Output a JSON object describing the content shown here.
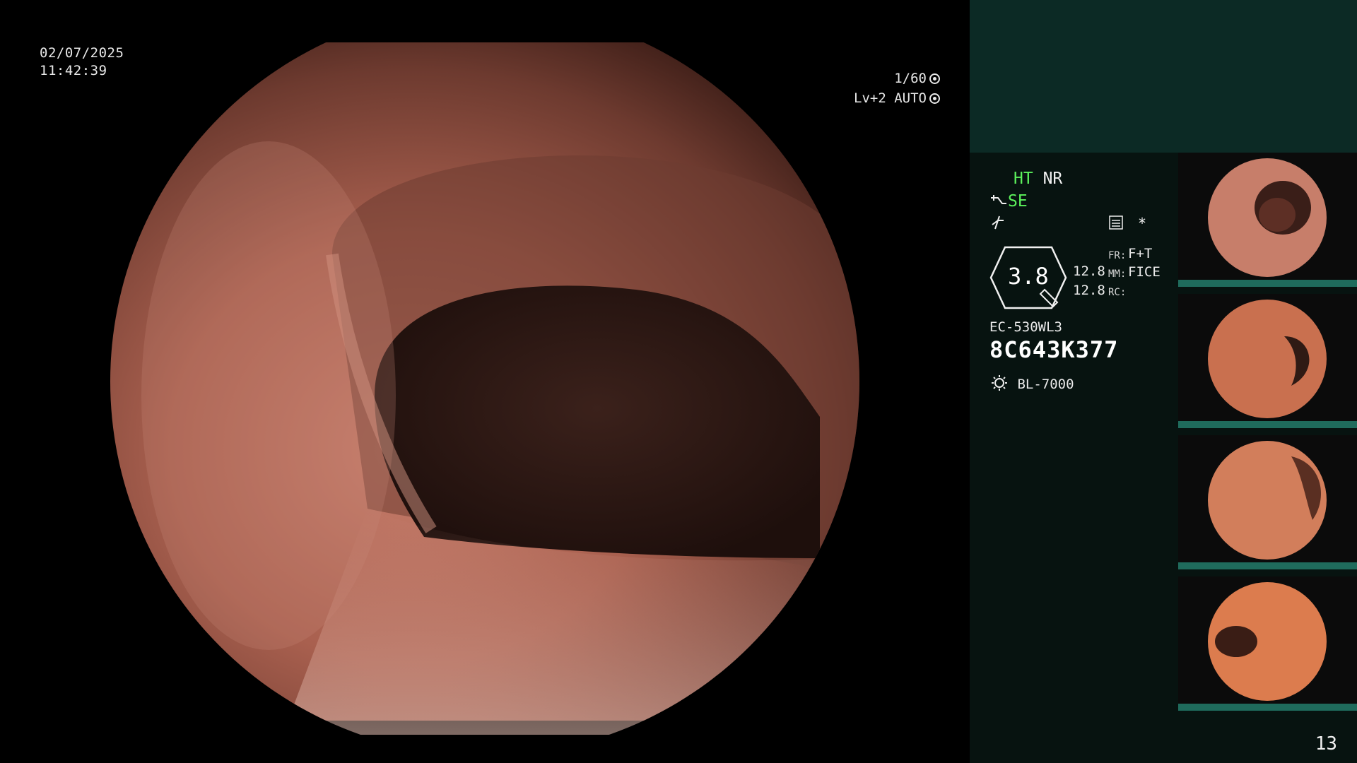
{
  "overlay": {
    "date": "02/07/2025",
    "time": "11:42:39",
    "shutter": "1/60",
    "level": "Lv+2 AUTO"
  },
  "side_panel": {
    "ht": "HT",
    "nr": "NR",
    "se": "SE",
    "badge_value": "3.8",
    "fr_label": "FR:",
    "fr_value": "F+T",
    "mm_label": "MM:",
    "mm_value": "FICE",
    "rc_label": "RC:",
    "value_1": "12.8",
    "value_2": "12.8",
    "asterisk": "*",
    "scope_model": "EC-530WL3",
    "serial": "8C643K377",
    "light_source": "BL-7000",
    "page_number": "13"
  },
  "colors": {
    "accent_green": "#5cf25c",
    "panel_bg": "#071310",
    "panel_top_bg": "#0c2a25",
    "thumb_bar": "#1f6b5c"
  },
  "icons": [
    "iris-icon",
    "camera-auto-icon",
    "scope-icon",
    "wave-icon",
    "notes-icon",
    "lamp-icon"
  ]
}
